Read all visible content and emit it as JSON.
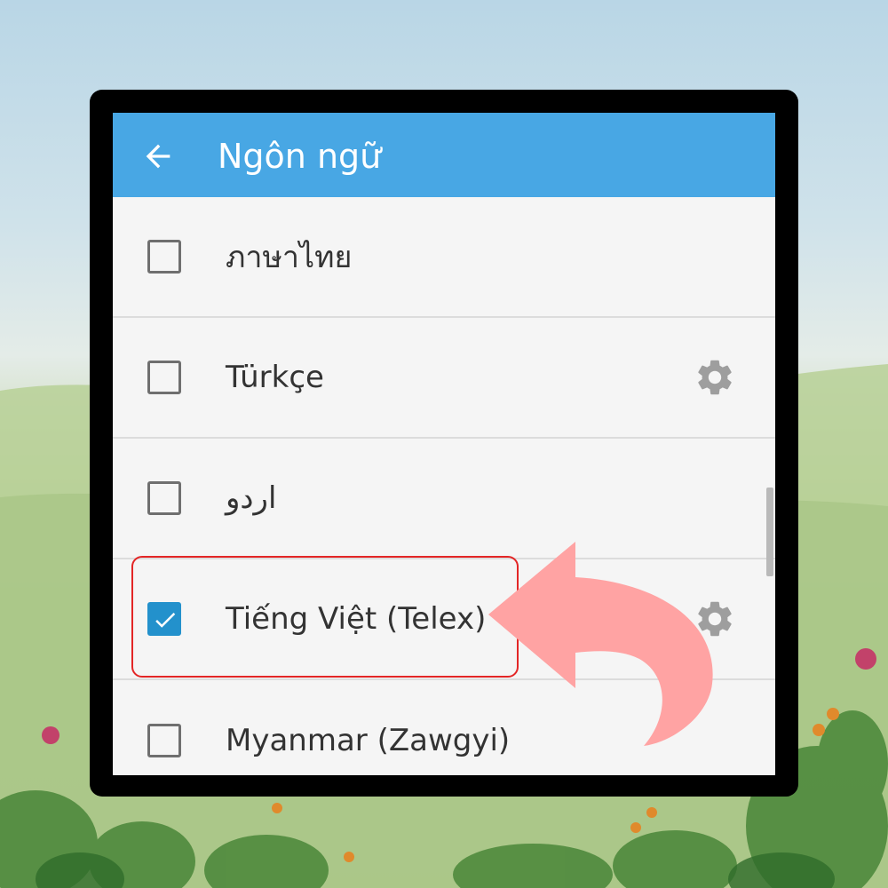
{
  "header": {
    "title": "Ngôn ngữ",
    "back_icon": "arrow-left-icon"
  },
  "languages": [
    {
      "label": "ภาษาไทย",
      "checked": false,
      "has_settings": false
    },
    {
      "label": "Türkçe",
      "checked": false,
      "has_settings": true
    },
    {
      "label": "اردو",
      "checked": false,
      "has_settings": false
    },
    {
      "label": "Tiếng Việt (Telex)",
      "checked": true,
      "has_settings": true
    },
    {
      "label": "Myanmar (Zawgyi)",
      "checked": false,
      "has_settings": false
    }
  ],
  "colors": {
    "appbar": "#48a7e4",
    "checkbox_checked": "#2391cc",
    "highlight_border": "#e32626",
    "annotation_arrow": "#ffa3a3"
  }
}
